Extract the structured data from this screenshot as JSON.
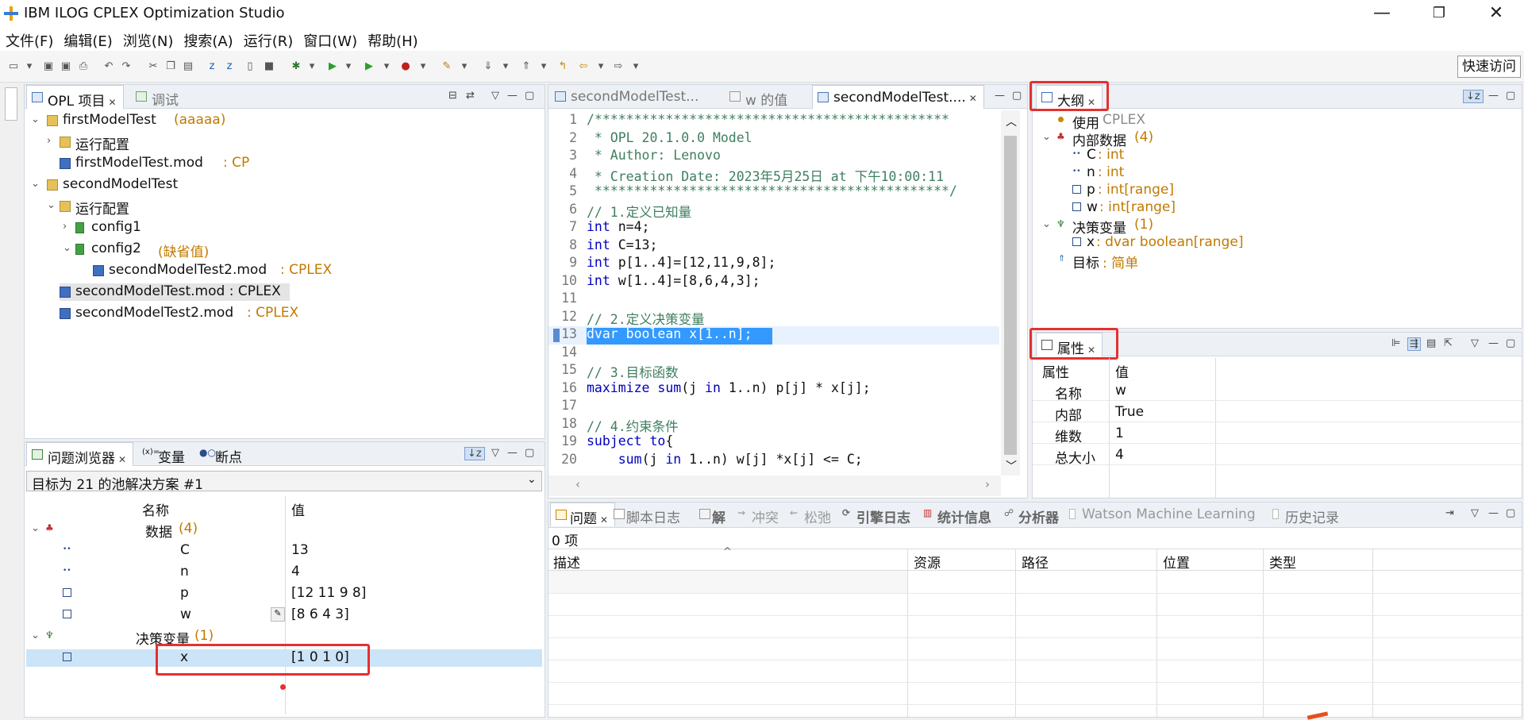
{
  "window": {
    "title": "IBM ILOG CPLEX Optimization Studio"
  },
  "menu": [
    "文件(F)",
    "编辑(E)",
    "浏览(N)",
    "搜索(A)",
    "运行(R)",
    "窗口(W)",
    "帮助(H)"
  ],
  "toolbar": {
    "quick_access": "快速访问"
  },
  "projects": {
    "tabs": [
      "OPL 项目",
      "调试"
    ],
    "items": [
      {
        "label": "firstModelTest",
        "suffix": "(aaaaa)"
      },
      {
        "label": "运行配置",
        "suffix": ""
      },
      {
        "label": "firstModelTest.mod",
        "suffix": ": CP"
      },
      {
        "label": "secondModelTest",
        "suffix": ""
      },
      {
        "label": "运行配置",
        "suffix": ""
      },
      {
        "label": "config1",
        "suffix": ""
      },
      {
        "label": "config2",
        "suffix": "(缺省值)"
      },
      {
        "label": "secondModelTest2.mod",
        "suffix": ": CPLEX"
      },
      {
        "label": "secondModelTest.mod : CPLEX",
        "suffix": ""
      },
      {
        "label": "secondModelTest2.mod",
        "suffix": ": CPLEX"
      }
    ]
  },
  "browser": {
    "tabs": [
      "问题浏览器",
      "变量",
      "断点"
    ],
    "dropdown": "目标为 21 的池解决方案 #1",
    "col_name": "名称",
    "col_value": "值",
    "data_group": "数据",
    "data_count": "(4)",
    "rows": [
      {
        "name": "C",
        "value": "13"
      },
      {
        "name": "n",
        "value": "4"
      },
      {
        "name": "p",
        "value": "[12 11 9 8]"
      },
      {
        "name": "w",
        "value": "[8 6 4 3]"
      }
    ],
    "dv_group": "决策变量",
    "dv_count": "(1)",
    "dv_rows": [
      {
        "name": "x",
        "value": "[1 0 1 0]"
      }
    ]
  },
  "editor": {
    "tabs": [
      "secondModelTest...",
      "w 的值",
      "secondModelTest...."
    ],
    "line_numbers": [
      "1",
      "2",
      "3",
      "4",
      "5",
      "6",
      "7",
      "8",
      "9",
      "10",
      "11",
      "12",
      "13",
      "14",
      "15",
      "16",
      "17",
      "18",
      "19",
      "20"
    ],
    "lines": [
      "/*********************************************",
      " * OPL 20.1.0.0 Model",
      " * Author: Lenovo",
      " * Creation Date: 2023年5月25日 at 下午10:00:11",
      " *********************************************/",
      "// 1.定义已知量",
      "int n=4;",
      "int C=13;",
      "int p[1..4]=[12,11,9,8];",
      "int w[1..4]=[8,6,4,3];",
      "",
      "// 2.定义决策变量",
      "dvar boolean x[1..n];",
      "",
      "// 3.目标函数",
      "maximize sum(j in 1..n) p[j] * x[j];",
      "",
      "// 4.约束条件",
      "subject to{",
      "    sum(j in 1..n) w[j] *x[j] <= C;"
    ]
  },
  "outline": {
    "tab": "大纲",
    "items": [
      {
        "label": "使用",
        "suffix": "CPLEX"
      },
      {
        "label": "内部数据",
        "suffix": "(4)"
      },
      {
        "label": "C",
        "suffix": ": int"
      },
      {
        "label": "n",
        "suffix": ": int"
      },
      {
        "label": "p",
        "suffix": ": int[range]"
      },
      {
        "label": "w",
        "suffix": ": int[range]"
      },
      {
        "label": "决策变量",
        "suffix": "(1)"
      },
      {
        "label": "x",
        "suffix": ": dvar boolean[range]"
      },
      {
        "label": "目标",
        "suffix": ": 简单"
      }
    ]
  },
  "properties": {
    "tab": "属性",
    "col_prop": "属性",
    "col_value": "值",
    "rows": [
      {
        "k": "名称",
        "v": "w"
      },
      {
        "k": "内部",
        "v": "True"
      },
      {
        "k": "维数",
        "v": "1"
      },
      {
        "k": "总大小",
        "v": "4"
      }
    ]
  },
  "problems": {
    "tabs": [
      "问题",
      "脚本日志",
      "解",
      "冲突",
      "松弛",
      "引擎日志",
      "统计信息",
      "分析器",
      "Watson Machine Learning",
      "历史记录"
    ],
    "count": "0 项",
    "columns": [
      "描述",
      "资源",
      "路径",
      "位置",
      "类型"
    ]
  }
}
